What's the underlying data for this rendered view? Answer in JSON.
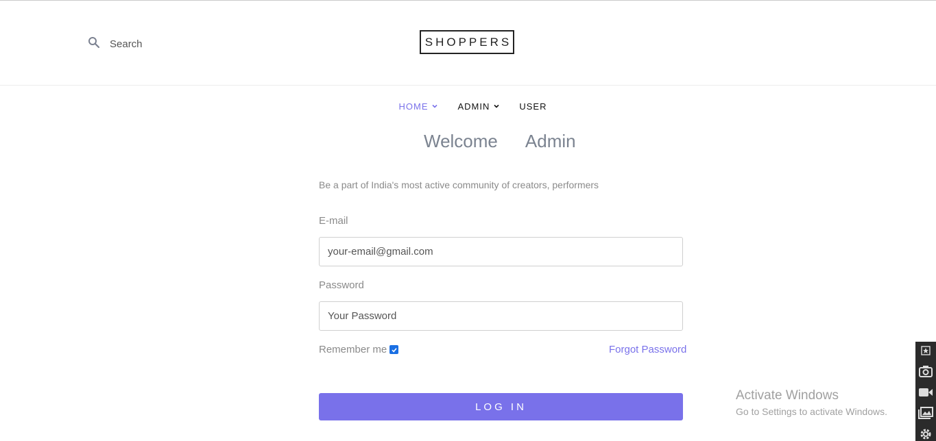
{
  "header": {
    "search_label": "Search",
    "logo": "SHOPPERS"
  },
  "nav": {
    "items": [
      {
        "label": "HOME",
        "has_dropdown": true,
        "active": true
      },
      {
        "label": "ADMIN",
        "has_dropdown": true,
        "active": false
      },
      {
        "label": "USER",
        "has_dropdown": false,
        "active": false
      }
    ]
  },
  "page": {
    "welcome_word": "Welcome",
    "welcome_role": "Admin",
    "tagline": "Be a part of India's most active community of creators, performers"
  },
  "form": {
    "email_label": "E-mail",
    "email_placeholder": "your-email@gmail.com",
    "password_label": "Password",
    "password_placeholder": "Your Password",
    "remember_label": "Remember me",
    "remember_checked": true,
    "forgot_label": "Forgot Password",
    "login_label": "LOG IN"
  },
  "watermark": {
    "title": "Activate Windows",
    "subtitle": "Go to Settings to activate Windows."
  },
  "colors": {
    "accent": "#7971ea",
    "checkbox": "#1a6fe3",
    "muted_text": "#8a8a8a"
  }
}
